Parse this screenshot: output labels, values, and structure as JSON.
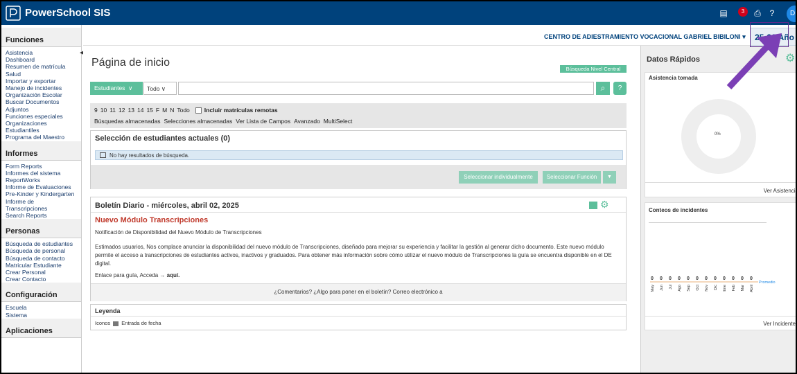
{
  "app": {
    "brand": "PowerSchool SIS"
  },
  "topbar": {
    "notifications": "3",
    "avatar": "DB"
  },
  "schoolbar": {
    "school": "CENTRO DE ADIESTRAMIENTO VOCACIONAL GABRIEL BIBILONI",
    "year": "25-26 Año"
  },
  "sidebar": {
    "sections": [
      {
        "title": "Funciones",
        "items": [
          "Asistencia",
          "Dashboard",
          "Resumen de matrícula",
          "Salud",
          "Importar y exportar",
          "Manejo de incidentes",
          "Organización Escolar",
          "Buscar Documentos Adjuntos",
          "Funciones especiales",
          "Organizaciones Estudiantiles",
          "Programa del Maestro"
        ]
      },
      {
        "title": "Informes",
        "items": [
          "Form Reports",
          "Informes del sistema",
          "ReportWorks",
          "Informe de Evaluaciones Pre-Kinder y Kindergarten",
          "Informe de Transcripciones",
          "Search Reports"
        ]
      },
      {
        "title": "Personas",
        "items": [
          "Búsqueda de estudiantes",
          "Búsqueda de personal",
          "Búsqueda de contacto",
          "Matricular Estudiante",
          "Crear Personal",
          "Crear Contacto"
        ]
      },
      {
        "title": "Configuración",
        "items": [
          "Escuela",
          "Sistema"
        ]
      },
      {
        "title": "Aplicaciones",
        "items": []
      }
    ]
  },
  "main": {
    "title": "Página de inicio",
    "central_search": "Búsqueda Nivel Central",
    "search": {
      "type": "Estudiantes",
      "scope": "Todo",
      "value": ""
    },
    "grades": [
      "9",
      "10",
      "11",
      "12",
      "13",
      "14",
      "15",
      "F",
      "M",
      "N",
      "Todo"
    ],
    "remote_label": "Incluir matrículas remotas",
    "search_links": [
      "Búsquedas almacenadas",
      "Selecciones almacenadas",
      "Ver Lista de Campos",
      "Avanzado",
      "MultiSelect"
    ],
    "selection": {
      "title": "Selección de estudiantes actuales (0)",
      "empty": "No hay resultados de búsqueda.",
      "btn_individual": "Seleccionar individualmente",
      "btn_function": "Seleccionar Función"
    },
    "bulletin": {
      "title": "Boletín Diario - miércoles, abril 02, 2025",
      "headline": "Nuevo Módulo Transcripciones",
      "subtitle": "Notificación de Disponibilidad del Nuevo Módulo de Transcripciones",
      "body": "Estimados usuarios, Nos complace anunciar la disponibilidad del nuevo módulo de Transcripciones, diseñado para mejorar su experiencia y facilitar la gestión al generar dicho documento. Este nuevo módulo permite el acceso a transcripciones de estudiantes activos, inactivos y graduados. Para obtener más información sobre cómo utilizar el nuevo módulo de Transcripciones la guía se encuentra disponible en el DE digital.",
      "guide_text": "Enlace para guía, Acceda →",
      "guide_link": "aquí.",
      "footer": "¿Comentarios? ¿Algo para poner en el boletín? Correo electrónico a"
    },
    "legend": {
      "title": "Leyenda",
      "icons_label": "Iconos",
      "date_entry": "Entrada de fecha"
    }
  },
  "right": {
    "title": "Datos Rápidos",
    "attendance": {
      "title": "Asistencia tomada",
      "percent": "0%",
      "link": "Ver Asistencia"
    },
    "incidents": {
      "title": "Conteos de incidentes",
      "link": "Ver Incidentes",
      "average_label": "Promedio"
    }
  },
  "chart_data": {
    "type": "bar",
    "title": "Conteos de incidentes",
    "categories": [
      "May",
      "Jun",
      "Jul",
      "Ago",
      "Sep",
      "Oct",
      "Nov",
      "Dic",
      "Ene",
      "Feb",
      "Mar",
      "Abril"
    ],
    "values": [
      0,
      0,
      0,
      0,
      0,
      0,
      0,
      0,
      0,
      0,
      0,
      0
    ],
    "series": [
      {
        "name": "Promedio",
        "values": [
          0,
          0,
          0,
          0,
          0,
          0,
          0,
          0,
          0,
          0,
          0,
          0
        ]
      }
    ]
  },
  "colors": {
    "header": "#00427c",
    "accent": "#5cbf9b",
    "headline": "#c0392b",
    "annotation": "#7b3fb5"
  }
}
